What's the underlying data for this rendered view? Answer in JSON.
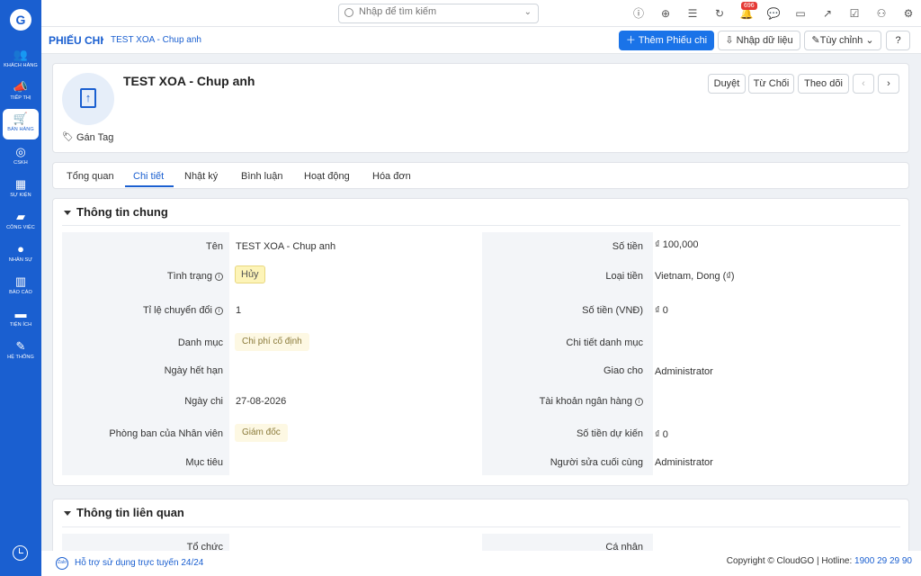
{
  "sidebar": {
    "logo": "G",
    "items": [
      {
        "label": "KHÁCH HÀNG",
        "icon": "users-icon",
        "glyph": "👥"
      },
      {
        "label": "TIẾP THỊ",
        "icon": "megaphone-icon",
        "glyph": "📣"
      },
      {
        "label": "BÁN HÀNG",
        "icon": "cart-icon",
        "glyph": "🛒"
      },
      {
        "label": "CSKH",
        "icon": "support-icon",
        "glyph": "◎"
      },
      {
        "label": "SỰ KIỆN",
        "icon": "calendar-icon",
        "glyph": "▦"
      },
      {
        "label": "CÔNG VIỆC",
        "icon": "briefcase-icon",
        "glyph": "▰"
      },
      {
        "label": "NHÂN SỰ",
        "icon": "person-icon",
        "glyph": "●"
      },
      {
        "label": "BÁO CÁO",
        "icon": "report-icon",
        "glyph": "▥"
      },
      {
        "label": "TIỆN ÍCH",
        "icon": "toolbox-icon",
        "glyph": "▬"
      },
      {
        "label": "HỆ THỐNG",
        "icon": "wrench-icon",
        "glyph": "✎"
      }
    ],
    "active_index": 2
  },
  "topbar": {
    "search_placeholder": "Nhập để tìm kiếm",
    "notification_count": "696",
    "icons": [
      "info-icon",
      "add-icon",
      "list-icon",
      "refresh-icon",
      "bell-icon",
      "chat-icon",
      "calendar-icon",
      "chart-icon",
      "checkbox-icon",
      "user-icon",
      "settings-icon"
    ]
  },
  "subbar": {
    "module": "PHIẾU CHI",
    "record": "TEST XOA - Chup anh",
    "add_button": "Thêm Phiếu chi",
    "import_button": "Nhập dữ liệu",
    "customize_button": "Tùy chỉnh"
  },
  "record": {
    "title": "TEST XOA - Chup anh",
    "tag_label": "Gán Tag",
    "approve": "Duyệt",
    "reject": "Từ Chối",
    "follow": "Theo dõi"
  },
  "tabs": [
    "Tổng quan",
    "Chi tiết",
    "Nhật ký",
    "Bình luận",
    "Hoạt động",
    "Hóa đơn"
  ],
  "active_tab": 1,
  "section_general": {
    "title": "Thông tin chung",
    "left": [
      {
        "label": "Tên",
        "value": "TEST XOA - Chup anh"
      },
      {
        "label": "Tình trạng",
        "value": "Hủy"
      },
      {
        "label": "Tỉ lệ chuyển đổi",
        "value": "1"
      },
      {
        "label": "Danh mục",
        "value": "Chi phí cố định"
      },
      {
        "label": "Ngày hết hạn",
        "value": ""
      },
      {
        "label": "Ngày chi",
        "value": "27-08-2026"
      },
      {
        "label": "Phòng ban của Nhân viên",
        "value": "Giám đốc"
      },
      {
        "label": "Mục tiêu",
        "value": ""
      }
    ],
    "right": [
      {
        "label": "Số tiền",
        "value": "₫ 100,000"
      },
      {
        "label": "Loại tiền",
        "value": "Vietnam, Dong (₫)"
      },
      {
        "label": "Số tiền (VNĐ)",
        "value": "₫ 0"
      },
      {
        "label": "Chi tiết danh mục",
        "value": ""
      },
      {
        "label": "Giao cho",
        "value": "Administrator"
      },
      {
        "label": "Tài khoản ngân hàng",
        "value": ""
      },
      {
        "label": "Số tiền dự kiến",
        "value": "₫ 0"
      },
      {
        "label": "Người sửa cuối cùng",
        "value": "Administrator"
      }
    ]
  },
  "section_related": {
    "title": "Thông tin liên quan",
    "left_label": "Tổ chức",
    "right_label": "Cá nhân"
  },
  "footer": {
    "help": "Hỗ trợ sử dụng trực tuyến 24/24",
    "copyright": "Copyright © CloudGO | Hotline:",
    "hotline": "1900 29 29 90"
  }
}
